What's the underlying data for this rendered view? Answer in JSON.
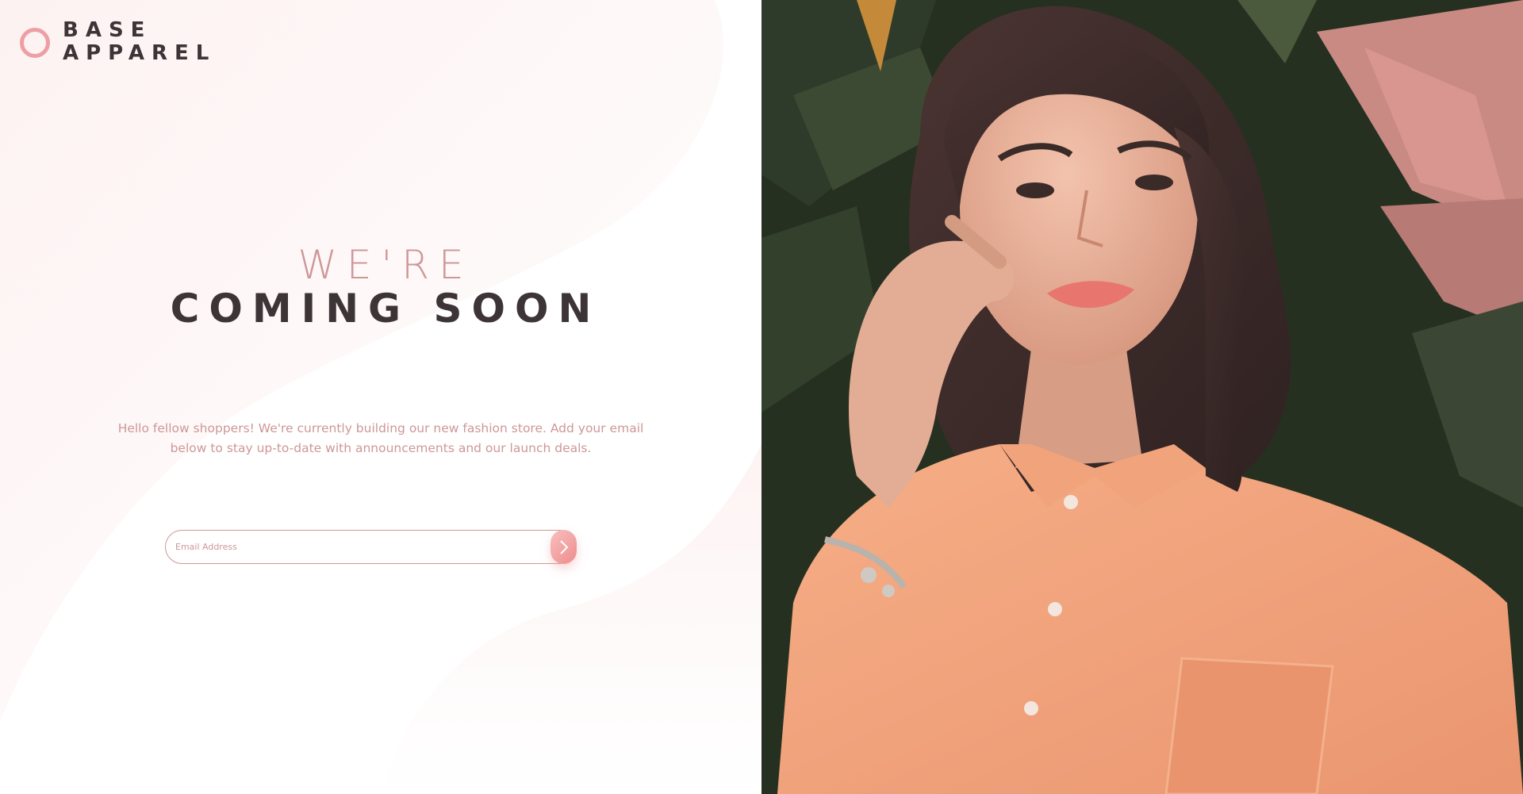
{
  "brand": {
    "line1": "BASE",
    "line2": "APPAREL",
    "accent_color": "#ee9fa3",
    "text_color": "#3d3438"
  },
  "headline": {
    "light": "WE'RE",
    "bold": "COMING SOON"
  },
  "intro_text": "Hello fellow shoppers! We're currently building our new fashion store. Add your email below to stay up-to-date with announcements and our launch deals.",
  "form": {
    "email_placeholder": "Email Address",
    "email_value": "",
    "submit_icon": "arrow-right-icon"
  },
  "hero_image": {
    "icon": "hero-photo"
  },
  "colors": {
    "desaturated_red": "#ce9797",
    "soft_red": "#f96464",
    "gradient_start": "#f8bfbf",
    "gradient_end": "#ee8c8c",
    "dark_grayish_red": "#423a3a"
  }
}
